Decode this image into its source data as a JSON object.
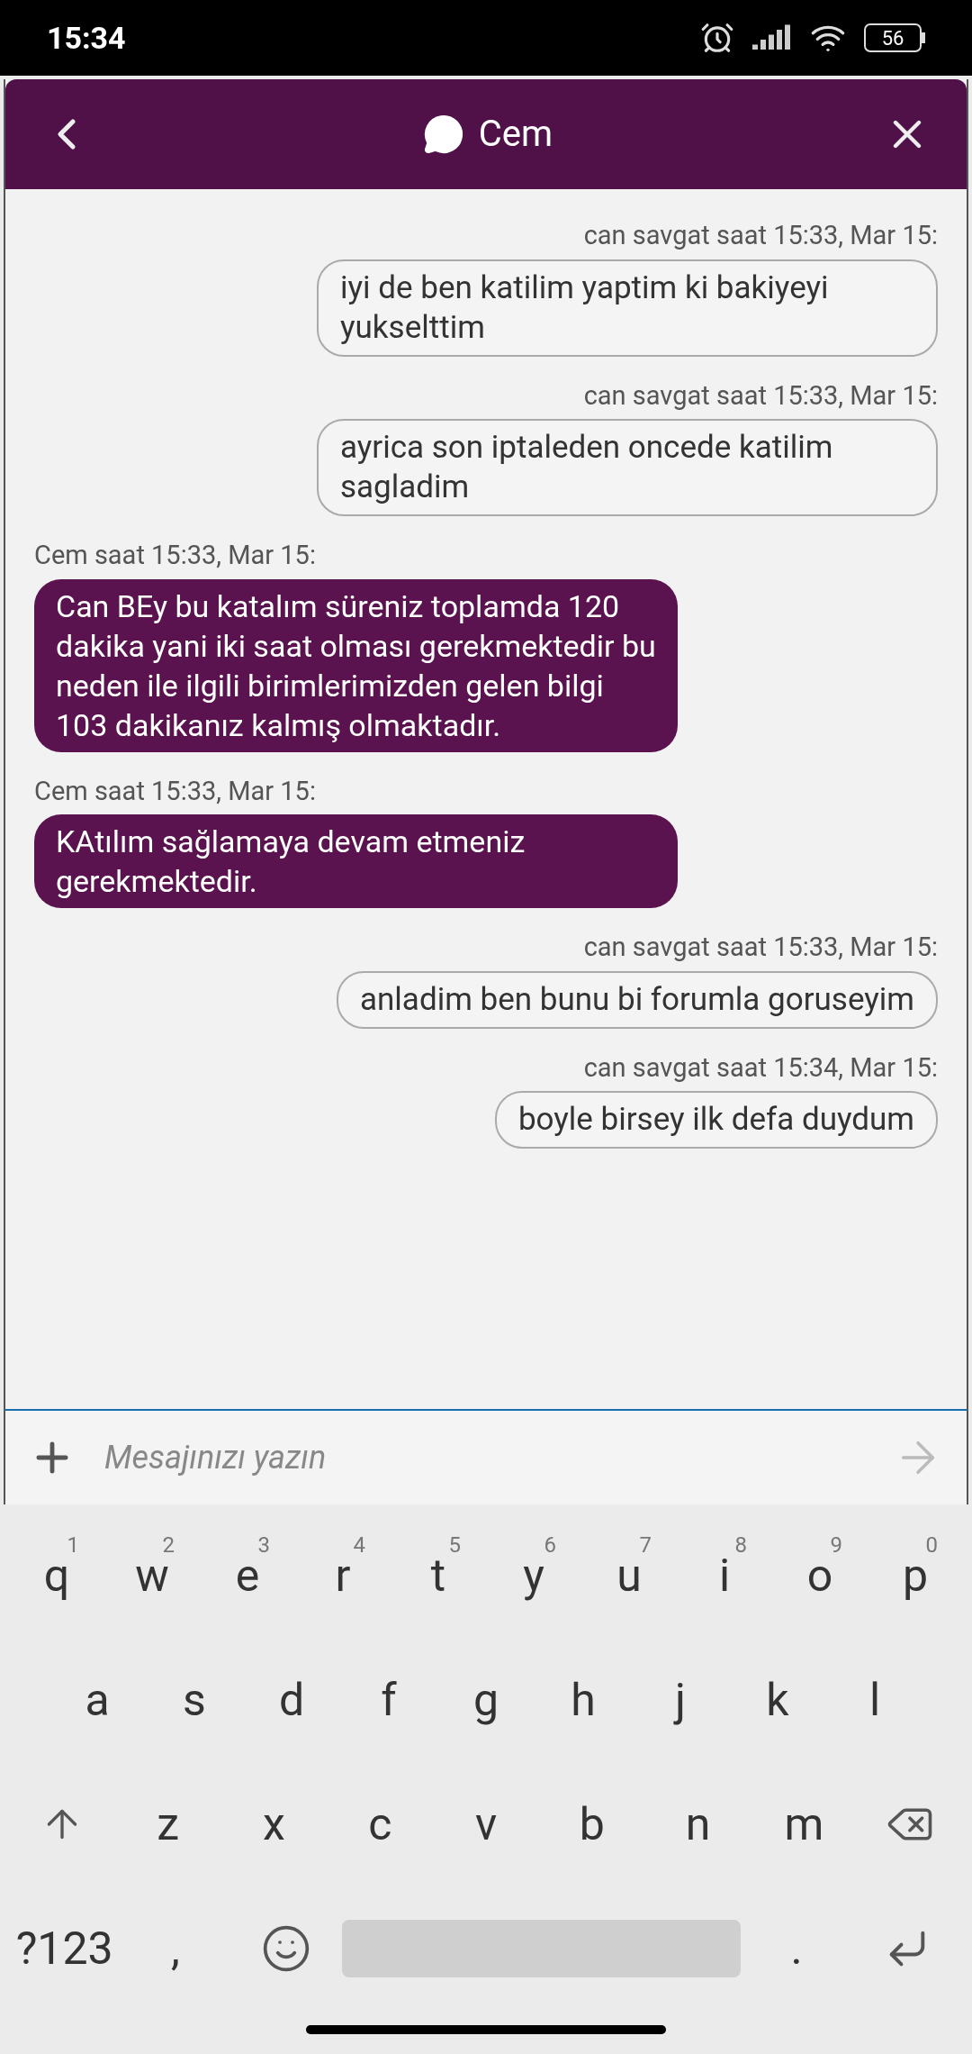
{
  "status_bar": {
    "time": "15:34",
    "battery": "56"
  },
  "chat_header": {
    "title": "Cem"
  },
  "messages": [
    {
      "kind": "outgoing",
      "meta": "can savgat saat 15:33, Mar 15:",
      "text": "iyi de ben katilim yaptim ki bakiyeyi yukselttim"
    },
    {
      "kind": "outgoing",
      "meta": "can savgat saat 15:33, Mar 15:",
      "text": "ayrica son iptaleden oncede katilim sagladim"
    },
    {
      "kind": "incoming",
      "meta": "Cem saat 15:33, Mar 15:",
      "text": "Can BEy bu katalım süreniz toplamda 120 dakika yani iki saat olması gerekmektedir bu neden ile ilgili birimlerimizden gelen bilgi 103 dakikanız kalmış olmaktadır."
    },
    {
      "kind": "incoming",
      "meta": "Cem saat 15:33, Mar 15:",
      "text": "KAtılım sağlamaya devam etmeniz gerekmektedir."
    },
    {
      "kind": "outgoing",
      "meta": "can savgat saat 15:33, Mar 15:",
      "text": "anladim ben bunu bi forumla goruseyim"
    },
    {
      "kind": "outgoing",
      "meta": "can savgat saat 15:34, Mar 15:",
      "text": "boyle birsey ilk defa duydum"
    }
  ],
  "composer": {
    "placeholder": "Mesajınızı yazın"
  },
  "keyboard": {
    "rows": [
      [
        {
          "kind": "char",
          "label": "q",
          "hint": "1"
        },
        {
          "kind": "char",
          "label": "w",
          "hint": "2"
        },
        {
          "kind": "char",
          "label": "e",
          "hint": "3"
        },
        {
          "kind": "char",
          "label": "r",
          "hint": "4"
        },
        {
          "kind": "char",
          "label": "t",
          "hint": "5"
        },
        {
          "kind": "char",
          "label": "y",
          "hint": "6"
        },
        {
          "kind": "char",
          "label": "u",
          "hint": "7"
        },
        {
          "kind": "char",
          "label": "i",
          "hint": "8"
        },
        {
          "kind": "char",
          "label": "o",
          "hint": "9"
        },
        {
          "kind": "char",
          "label": "p",
          "hint": "0"
        }
      ],
      [
        {
          "kind": "char",
          "label": "a"
        },
        {
          "kind": "char",
          "label": "s"
        },
        {
          "kind": "char",
          "label": "d"
        },
        {
          "kind": "char",
          "label": "f"
        },
        {
          "kind": "char",
          "label": "g"
        },
        {
          "kind": "char",
          "label": "h"
        },
        {
          "kind": "char",
          "label": "j"
        },
        {
          "kind": "char",
          "label": "k"
        },
        {
          "kind": "char",
          "label": "l"
        }
      ],
      [
        {
          "kind": "shift"
        },
        {
          "kind": "char",
          "label": "z"
        },
        {
          "kind": "char",
          "label": "x"
        },
        {
          "kind": "char",
          "label": "c"
        },
        {
          "kind": "char",
          "label": "v"
        },
        {
          "kind": "char",
          "label": "b"
        },
        {
          "kind": "char",
          "label": "n"
        },
        {
          "kind": "char",
          "label": "m"
        },
        {
          "kind": "backspace"
        }
      ],
      [
        {
          "kind": "char",
          "label": "?123"
        },
        {
          "kind": "char",
          "label": ","
        },
        {
          "kind": "emoji"
        },
        {
          "kind": "space"
        },
        {
          "kind": "char",
          "label": "."
        },
        {
          "kind": "enter"
        }
      ]
    ]
  }
}
